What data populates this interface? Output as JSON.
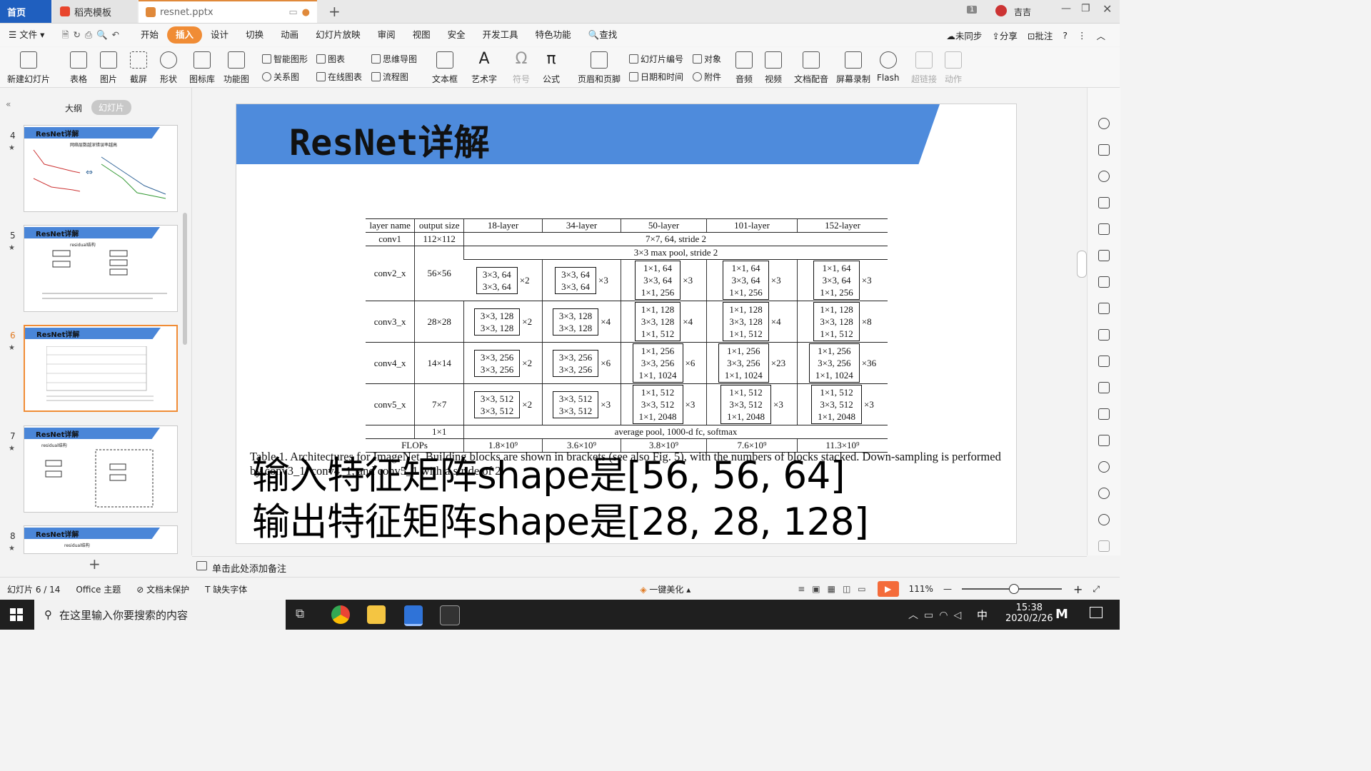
{
  "tabs": {
    "home": "首页",
    "template": "稻壳模板",
    "file": "resnet.pptx"
  },
  "titlebar_right": {
    "badge": "1",
    "user": "吉吉"
  },
  "menu": {
    "file": "文件",
    "items": [
      "开始",
      "插入",
      "设计",
      "切换",
      "动画",
      "幻灯片放映",
      "审阅",
      "视图",
      "安全",
      "开发工具",
      "特色功能"
    ],
    "active": "插入",
    "search": "查找",
    "sync": "未同步",
    "share": "分享",
    "comment": "批注"
  },
  "ribbon": {
    "big": [
      "新建幻灯片",
      "表格",
      "图片",
      "截屏",
      "形状",
      "图标库",
      "功能图"
    ],
    "small_a": [
      "智能图形",
      "关系图"
    ],
    "small_b": [
      "图表",
      "在线图表"
    ],
    "small_c": [
      "思维导图",
      "流程图"
    ],
    "big2": [
      "文本框",
      "艺术字",
      "符号",
      "公式",
      "页眉和页脚"
    ],
    "small_d": [
      "幻灯片编号",
      "日期和时间"
    ],
    "small_e": [
      "对象",
      "附件"
    ],
    "big3": [
      "音频",
      "视频",
      "文档配音",
      "屏幕录制",
      "Flash",
      "超链接",
      "动作"
    ]
  },
  "left_panel": {
    "outline_tab": "大纲",
    "slides_tab": "幻灯片",
    "slide_title": "ResNet详解",
    "numbers": [
      "4",
      "5",
      "6",
      "7",
      "8"
    ],
    "selected": "6",
    "thumb_labels": {
      "t4": "网络层数越深错误率越高",
      "t5": "residual结构",
      "t7": "residual结构",
      "t8": "residual结构"
    }
  },
  "slide": {
    "title": "ResNet详解",
    "table": {
      "headers": [
        "layer name",
        "output size",
        "18-layer",
        "34-layer",
        "50-layer",
        "101-layer",
        "152-layer"
      ],
      "conv1": {
        "name": "conv1",
        "size": "112×112",
        "desc": "7×7, 64, stride 2"
      },
      "maxpool": "3×3 max pool, stride 2",
      "rows": [
        {
          "name": "conv2_x",
          "size": "56×56",
          "b18": [
            "3×3, 64",
            "3×3, 64"
          ],
          "m18": "×2",
          "b34": [
            "3×3, 64",
            "3×3, 64"
          ],
          "m34": "×3",
          "b50": [
            "1×1, 64",
            "3×3, 64",
            "1×1, 256"
          ],
          "m50": "×3",
          "b101": [
            "1×1, 64",
            "3×3, 64",
            "1×1, 256"
          ],
          "m101": "×3",
          "b152": [
            "1×1, 64",
            "3×3, 64",
            "1×1, 256"
          ],
          "m152": "×3"
        },
        {
          "name": "conv3_x",
          "size": "28×28",
          "b18": [
            "3×3, 128",
            "3×3, 128"
          ],
          "m18": "×2",
          "b34": [
            "3×3, 128",
            "3×3, 128"
          ],
          "m34": "×4",
          "b50": [
            "1×1, 128",
            "3×3, 128",
            "1×1, 512"
          ],
          "m50": "×4",
          "b101": [
            "1×1, 128",
            "3×3, 128",
            "1×1, 512"
          ],
          "m101": "×4",
          "b152": [
            "1×1, 128",
            "3×3, 128",
            "1×1, 512"
          ],
          "m152": "×8"
        },
        {
          "name": "conv4_x",
          "size": "14×14",
          "b18": [
            "3×3, 256",
            "3×3, 256"
          ],
          "m18": "×2",
          "b34": [
            "3×3, 256",
            "3×3, 256"
          ],
          "m34": "×6",
          "b50": [
            "1×1, 256",
            "3×3, 256",
            "1×1, 1024"
          ],
          "m50": "×6",
          "b101": [
            "1×1, 256",
            "3×3, 256",
            "1×1, 1024"
          ],
          "m101": "×23",
          "b152": [
            "1×1, 256",
            "3×3, 256",
            "1×1, 1024"
          ],
          "m152": "×36"
        },
        {
          "name": "conv5_x",
          "size": "7×7",
          "b18": [
            "3×3, 512",
            "3×3, 512"
          ],
          "m18": "×2",
          "b34": [
            "3×3, 512",
            "3×3, 512"
          ],
          "m34": "×3",
          "b50": [
            "1×1, 512",
            "3×3, 512",
            "1×1, 2048"
          ],
          "m50": "×3",
          "b101": [
            "1×1, 512",
            "3×3, 512",
            "1×1, 2048"
          ],
          "m101": "×3",
          "b152": [
            "1×1, 512",
            "3×3, 512",
            "1×1, 2048"
          ],
          "m152": "×3"
        }
      ],
      "final": {
        "size": "1×1",
        "desc": "average pool, 1000-d fc, softmax"
      },
      "flops": {
        "label": "FLOPs",
        "values": [
          "1.8×10⁹",
          "3.6×10⁹",
          "3.8×10⁹",
          "7.6×10⁹",
          "11.3×10⁹"
        ]
      }
    },
    "caption": "Table 1. Architectures for ImageNet. Building blocks are shown in brackets (see also Fig. 5), with the numbers of blocks stacked. Down-sampling is performed by conv3_1, conv4_1, and conv5_1 with a stride of 2.",
    "subtitle1": "输入特征矩阵shape是[56, 56, 64]",
    "subtitle2": "输出特征矩阵shape是[28, 28, 128]"
  },
  "notes_placeholder": "单击此处添加备注",
  "status": {
    "slide_counter": "幻灯片 6 / 14",
    "theme": "Office 主题",
    "protect": "文档未保护",
    "font": "缺失字体",
    "beautify": "一键美化",
    "zoom": "111%"
  },
  "taskbar": {
    "search_placeholder": "在这里输入你要搜索的内容",
    "time": "15:38",
    "date": "2020/2/26",
    "ime": "中"
  },
  "colors": {
    "accent": "#f08c35",
    "banner": "#4e8bdc",
    "home_tab": "#1f5fbf"
  }
}
